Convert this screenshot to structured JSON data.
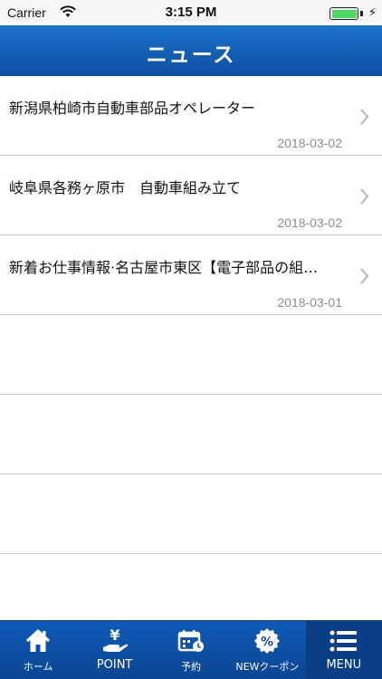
{
  "status_bar": {
    "carrier": "Carrier",
    "time": "3:15 PM"
  },
  "header": {
    "title": "ニュース"
  },
  "news": [
    {
      "title": "新潟県柏崎市自動車部品オペレーター",
      "date": "2018-03-02"
    },
    {
      "title": "岐阜県各務ヶ原市　自動車組み立て",
      "date": "2018-03-02"
    },
    {
      "title": "新着お仕事情報·名古屋市東区【電子部品の組…",
      "date": "2018-03-01"
    }
  ],
  "tabs": [
    {
      "label": "ホーム",
      "icon": "home-icon"
    },
    {
      "label": "POINT",
      "icon": "yen-hand-icon"
    },
    {
      "label": "予約",
      "icon": "calendar-icon"
    },
    {
      "label": "NEWクーポン",
      "icon": "coupon-icon"
    },
    {
      "label": "MENU",
      "icon": "menu-icon"
    }
  ],
  "colors": {
    "primary_blue": "#0d4fa3",
    "tab_active": "#0b3e85",
    "date_gray": "#8e8e8e",
    "battery_green": "#4cd964"
  }
}
